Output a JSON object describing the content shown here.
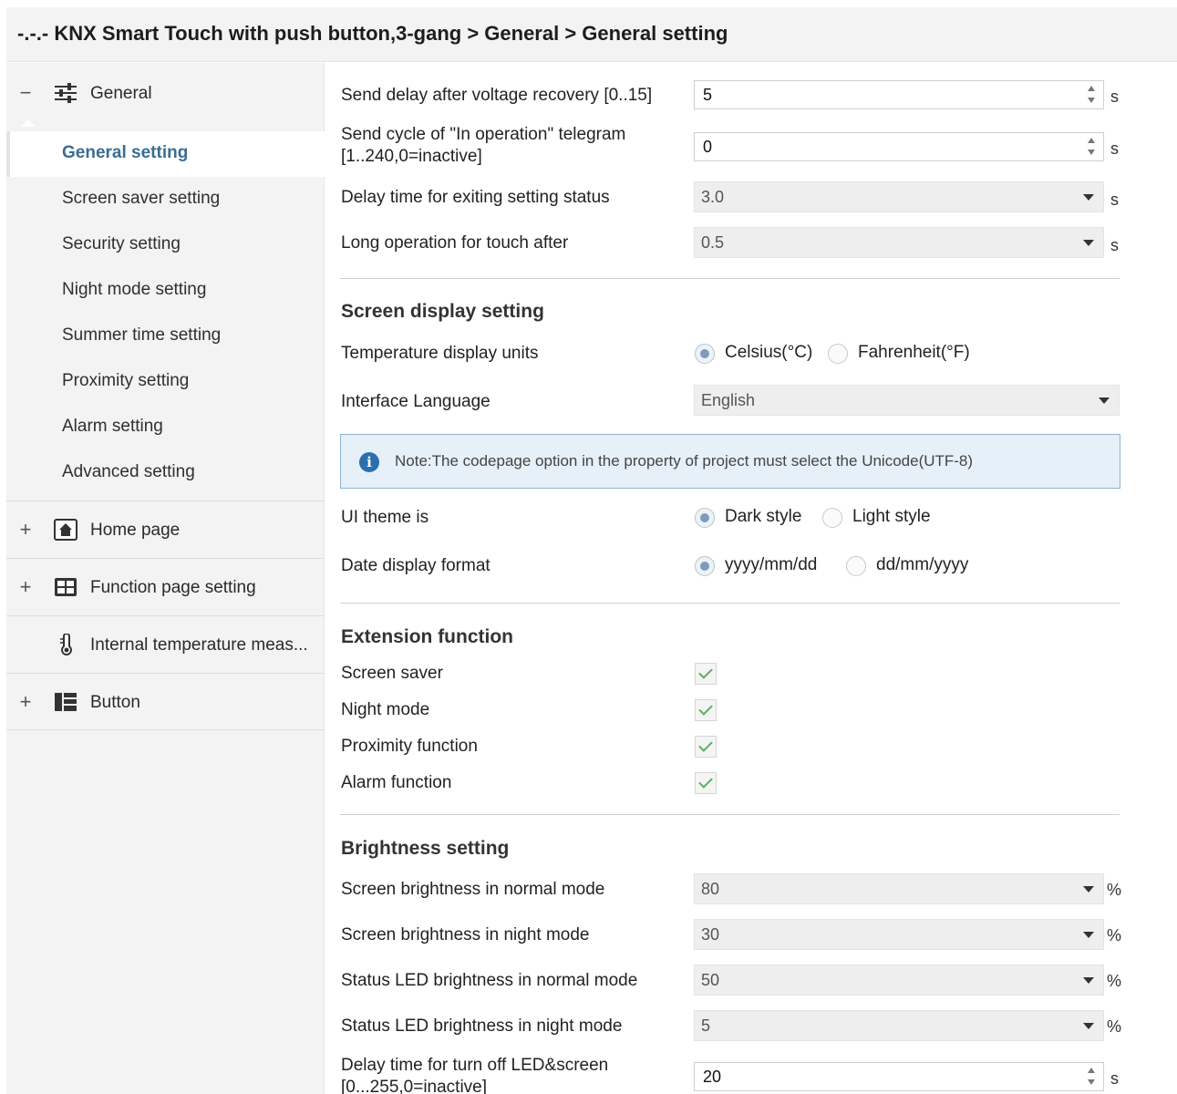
{
  "title": "-.-.- KNX Smart Touch with push button,3-gang > General > General setting",
  "sidebar": {
    "general": {
      "label": "General",
      "expander": "−"
    },
    "sub_items": [
      "General setting",
      "Screen saver setting",
      "Security setting",
      "Night mode setting",
      "Summer time setting",
      "Proximity setting",
      "Alarm setting",
      "Advanced setting"
    ],
    "groups": [
      {
        "label": "Home page",
        "expander": "+"
      },
      {
        "label": "Function page setting",
        "expander": "+"
      },
      {
        "label": "Internal temperature meas...",
        "expander": ""
      },
      {
        "label": "Button",
        "expander": "+"
      }
    ]
  },
  "general": {
    "send_delay": {
      "label": "Send delay after voltage recovery [0..15]",
      "value": "5",
      "unit": "s"
    },
    "send_cycle": {
      "label_line1": "Send cycle of  \"In operation\" telegram",
      "label_line2": "[1..240,0=inactive]",
      "value": "0",
      "unit": "s"
    },
    "exit_delay": {
      "label": "Delay time for exiting setting status",
      "value": "3.0",
      "unit": "s"
    },
    "long_op": {
      "label": "Long operation for touch after",
      "value": "0.5",
      "unit": "s"
    }
  },
  "screen_display": {
    "heading": "Screen display setting",
    "temp_units": {
      "label": "Temperature display units",
      "options": [
        "Celsius(°C)",
        "Fahrenheit(°F)"
      ],
      "selected": "Celsius(°C)"
    },
    "language": {
      "label": "Interface Language",
      "value": "English"
    },
    "note": "Note:The codepage option in the property of project must select the Unicode(UTF-8)",
    "ui_theme": {
      "label": "UI theme is",
      "options": [
        "Dark style",
        "Light style"
      ],
      "selected": "Dark style"
    },
    "date_format": {
      "label": "Date display format",
      "options": [
        "yyyy/mm/dd",
        "dd/mm/yyyy"
      ],
      "selected": "yyyy/mm/dd"
    }
  },
  "extension": {
    "heading": "Extension function",
    "items": [
      "Screen saver",
      "Night mode",
      "Proximity function",
      "Alarm function"
    ],
    "checked": [
      true,
      true,
      true,
      true
    ]
  },
  "brightness": {
    "heading": "Brightness setting",
    "normal_screen": {
      "label": "Screen brightness in normal mode",
      "value": "80",
      "unit": "%"
    },
    "night_screen": {
      "label": "Screen brightness in night mode",
      "value": "30",
      "unit": "%"
    },
    "led_normal": {
      "label": "Status LED brightness in normal mode",
      "value": "50",
      "unit": "%"
    },
    "led_night": {
      "label": "Status LED brightness in night mode",
      "value": "5",
      "unit": "%"
    },
    "turn_off": {
      "label_line1": "Delay time for turn off LED&screen",
      "label_line2": "[0...255,0=inactive]",
      "value": "20",
      "unit": "s"
    }
  },
  "colors": {
    "accent": "#3a6d94",
    "sidebar_bg": "#f3f3f3",
    "note_bg": "#e6f0f8",
    "check": "#5fae5f"
  }
}
